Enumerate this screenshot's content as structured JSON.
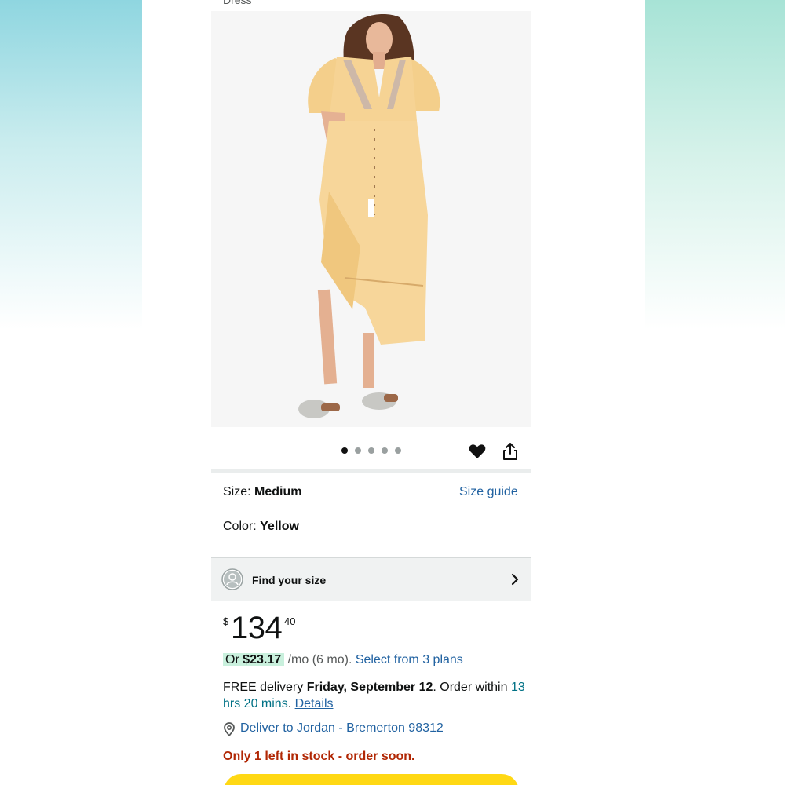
{
  "product": {
    "title_fragment": "Dress",
    "image_alt": "Yellow dress",
    "carousel": {
      "count": 5,
      "active_index": 0
    }
  },
  "selection": {
    "size_label": "Size: ",
    "size_value": "Medium",
    "size_guide": "Size guide",
    "color_label": "Color: ",
    "color_value": "Yellow"
  },
  "find_size": {
    "label": "Find your size"
  },
  "price": {
    "currency": "$",
    "whole": "134",
    "fraction": "40"
  },
  "installments": {
    "prefix": "Or ",
    "amount": "$23.17",
    "terms": " /mo (6 mo). ",
    "plans_link": "Select from 3 plans"
  },
  "delivery": {
    "prefix": "FREE delivery ",
    "date": "Friday, September 12",
    "mid": ". Order within ",
    "cutoff": "13 hrs 20 mins",
    "sep": ". ",
    "details": "Details"
  },
  "deliver_to": {
    "text": "Deliver to Jordan - Bremerton 98312"
  },
  "stock": {
    "text": "Only 1 left in stock - order soon."
  },
  "colors": {
    "link": "#2162a1",
    "teal": "#007185",
    "stock_red": "#b12704",
    "cart_yellow": "#ffd814",
    "installment_highlight": "#c9f0dd"
  },
  "icons": [
    "heart-icon",
    "share-icon",
    "person-icon",
    "chevron-right-icon",
    "location-pin-icon"
  ]
}
